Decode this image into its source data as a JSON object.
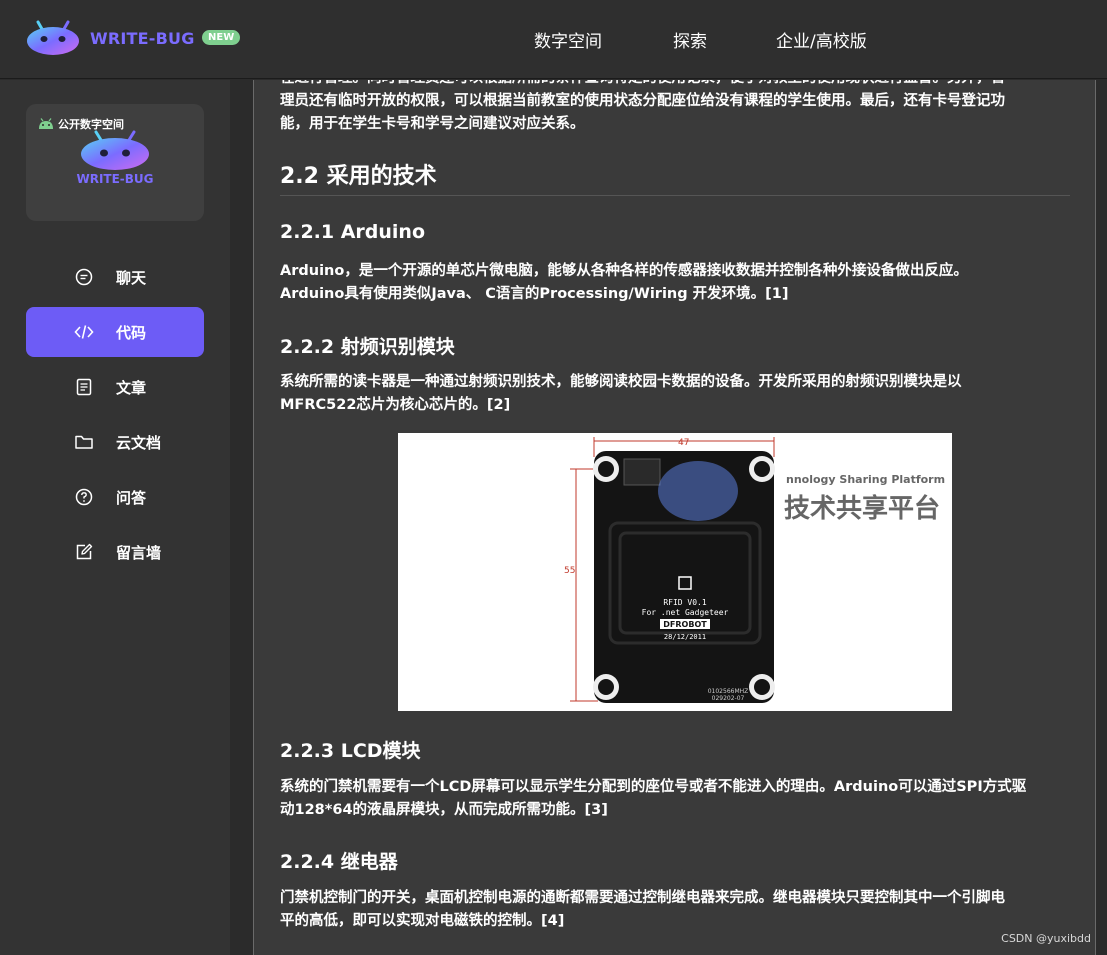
{
  "header": {
    "brand": "WRITE-BUG",
    "badge": "NEW",
    "nav": [
      "数字空间",
      "探索",
      "企业/高校版"
    ]
  },
  "sidebar": {
    "card": {
      "tag": "公开数字空间",
      "brand": "WRITE-BUG"
    },
    "items": [
      {
        "label": "聊天",
        "icon": "chat-icon"
      },
      {
        "label": "代码",
        "icon": "code-icon",
        "active": true
      },
      {
        "label": "文章",
        "icon": "article-icon"
      },
      {
        "label": "云文档",
        "icon": "folder-icon"
      },
      {
        "label": "问答",
        "icon": "question-icon"
      },
      {
        "label": "留言墙",
        "icon": "edit-icon"
      }
    ]
  },
  "article": {
    "intro_line1": "在进行管理。同时管理员还可以根据所需的条件查询特定的使用记录，便于对教室的使用现状进行监督。另外，管",
    "intro_line2": "理员还有临时开放的权限，可以根据当前教室的使用状态分配座位给没有课程的学生使用。最后，还有卡号登记功",
    "intro_line3": "能，用于在学生卡号和学号之间建议对应关系。",
    "h2": "2.2 采用的技术",
    "s1_title": "2.2.1 Arduino",
    "s1_line1": "Arduino，是一个开源的单芯片微电脑，能够从各种各样的传感器接收数据并控制各种外接设备做出反应。",
    "s1_line2": "Arduino具有使用类似Java、 C语言的Processing/Wiring 开发环境。[1]",
    "s2_title": "2.2.2 射频识别模块",
    "s2_line1": "系统所需的读卡器是一种通过射频识别技术，能够阅读校园卡数据的设备。开发所采用的射频识别模块是以",
    "s2_line2": "MFRC522芯片为核心芯片的。[2]",
    "figure": {
      "watermark_en": "nnology Sharing Platform",
      "watermark_cn": "技术共享平台",
      "dim_top": "47",
      "dim_side": "55",
      "board_lines": [
        "RFID V0.1",
        "For .net Gadgeteer",
        "DFROBOT",
        "28/12/2011"
      ],
      "board_code": "0102566MHZ",
      "board_code2": "029202-07"
    },
    "s3_title": "2.2.3 LCD模块",
    "s3_line1": "系统的门禁机需要有一个LCD屏幕可以显示学生分配到的座位号或者不能进入的理由。Arduino可以通过SPI方式驱",
    "s3_line2": "动128*64的液晶屏模块，从而完成所需功能。[3]",
    "s4_title": "2.2.4 继电器",
    "s4_line1": "门禁机控制门的开关，桌面机控制电源的通断都需要通过控制继电器来完成。继电器模块只要控制其中一个引脚电",
    "s4_line2": "平的高低，即可以实现对电磁铁的控制。[4]"
  },
  "footer": {
    "credit": "CSDN @yuxibdd"
  },
  "colors": {
    "accent": "#6d5cf6",
    "badge": "#7fcf8f",
    "panel": "#3a3a3a",
    "sidebar": "#333333"
  }
}
